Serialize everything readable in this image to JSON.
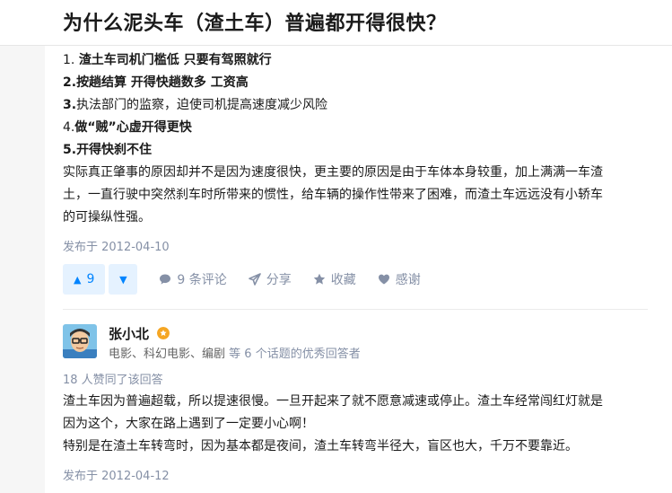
{
  "question": {
    "title": "为什么泥头车（渣土车）普遍都开得很快？"
  },
  "answer1": {
    "reasons": [
      {
        "num": "1.",
        "text": "渣土车司机门槛低 只要有驾照就行",
        "num_bold": false,
        "text_bold": true
      },
      {
        "num": "2.",
        "text": "按趟结算 开得快趟数多 工资高",
        "num_bold": true,
        "text_bold": true
      },
      {
        "num": "3.",
        "text": "执法部门的监察，迫使司机提高速度减少风险",
        "num_bold": true,
        "text_bold": false
      },
      {
        "num": "4.",
        "text": "做“贼”心虚开得更快",
        "num_bold": false,
        "text_bold": true
      },
      {
        "num": "5.",
        "text": "开得快刹不住",
        "num_bold": true,
        "text_bold": true
      }
    ],
    "paragraph_lines": [
      "实际真正肇事的原因却并不是因为速度很快，更主要的原因是由于车体本身较重，加上满满一车渣",
      "土，一直行驶中突然刹车时所带来的惯性，给车辆的操作性带来了困难，而渣土车远远没有小轿车",
      "的可操纵性强。"
    ],
    "published": "发布于 2012-04-10",
    "upvote_count": "9",
    "comments_label": "9 条评论",
    "share_label": "分享",
    "collect_label": "收藏",
    "thanks_label": "感谢"
  },
  "answer2": {
    "author_name": "张小北",
    "author_topics": "电影、科幻电影、编剧",
    "author_suffix": "等 6 个话题的优秀回答者",
    "approvals": "18 人赞同了该回答",
    "paragraph_lines": [
      "渣土车因为普遍超载，所以提速很慢。一旦开起来了就不愿意减速或停止。渣土车经常闯红灯就是",
      "因为这个，大家在路上遇到了一定要小心啊！",
      "特别是在渣土车转弯时，因为基本都是夜间，渣土车转弯半径大，盲区也大，千万不要靠近。"
    ],
    "published": "发布于 2012-04-12"
  },
  "icons": [
    "upvote-icon",
    "downvote-icon",
    "comment-icon",
    "share-icon",
    "star-icon",
    "heart-icon",
    "excellence-badge-icon"
  ],
  "colors": {
    "accent": "#0084ff",
    "accent_bg": "#e5f2ff",
    "meta_gray": "#8590a6",
    "badge": "#f5a623"
  }
}
